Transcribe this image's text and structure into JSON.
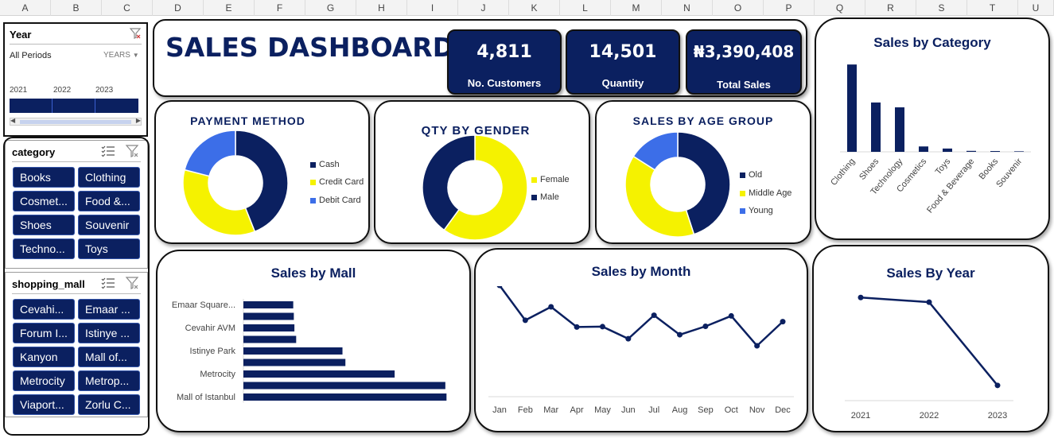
{
  "columns": [
    "A",
    "B",
    "C",
    "D",
    "E",
    "F",
    "G",
    "H",
    "I",
    "J",
    "K",
    "L",
    "M",
    "N",
    "O",
    "P",
    "Q",
    "R",
    "S",
    "T",
    "U"
  ],
  "colors": {
    "navy": "#0b2060",
    "yellow": "#f5f200",
    "blue": "#3c6ee8"
  },
  "title": "SALES DASHBOARD",
  "kpis": [
    {
      "value": "4,811",
      "label": "No. Customers"
    },
    {
      "value": "14,501",
      "label": "Quantity"
    },
    {
      "value": "₦3,390,408",
      "label": "Total Sales"
    }
  ],
  "year_slicer": {
    "header": "Year",
    "filter_label": "All Periods",
    "level_label": "YEARS",
    "years": [
      "2021",
      "2022",
      "2023"
    ]
  },
  "category_slicer": {
    "header": "category",
    "items": [
      "Books",
      "Clothing",
      "Cosmet...",
      "Food &...",
      "Shoes",
      "Souvenir",
      "Techno...",
      "Toys"
    ]
  },
  "mall_slicer": {
    "header": "shopping_mall",
    "items": [
      "Cevahi...",
      "Emaar ...",
      "Forum I...",
      "Istinye ...",
      "Kanyon",
      "Mall of...",
      "Metrocity",
      "Metrop...",
      "Viaport...",
      "Zorlu C..."
    ]
  },
  "payment": {
    "title": "PAYMENT METHOD",
    "legend": [
      "Cash",
      "Credit Card",
      "Debit Card"
    ]
  },
  "gender": {
    "title": "QTY BY GENDER",
    "legend": [
      "Female",
      "Male"
    ]
  },
  "age": {
    "title": "SALES BY AGE GROUP",
    "legend": [
      "Old",
      "Middle Age",
      "Young"
    ]
  },
  "chart_data": [
    {
      "type": "pie",
      "categories": [
        "Cash",
        "Credit Card",
        "Debit Card"
      ],
      "values": [
        44,
        35,
        21
      ],
      "colors": [
        "#0b2060",
        "#f5f200",
        "#3c6ee8"
      ]
    },
    {
      "type": "pie",
      "categories": [
        "Female",
        "Male"
      ],
      "values": [
        60,
        40
      ],
      "colors": [
        "#f5f200",
        "#0b2060"
      ]
    },
    {
      "type": "pie",
      "categories": [
        "Old",
        "Middle Age",
        "Young"
      ],
      "values": [
        45,
        39,
        16
      ],
      "colors": [
        "#0b2060",
        "#f5f200",
        "#3c6ee8"
      ]
    },
    {
      "type": "bar",
      "title": "Sales by Category",
      "categories": [
        "Clothing",
        "Shoes",
        "Technology",
        "Cosmetics",
        "Toys",
        "Food & Beverage",
        "Books",
        "Souvenir"
      ],
      "values": [
        1007,
        569,
        513,
        62,
        38,
        11,
        9,
        6
      ],
      "ylim": [
        0,
        1100
      ]
    },
    {
      "type": "bar",
      "orientation": "horizontal",
      "title": "Sales by Mall",
      "categories": [
        "Emaar Square...",
        "",
        "Cevahir AVM",
        "",
        "Istinye Park",
        "",
        "Metrocity",
        "",
        "Mall of Istanbul"
      ],
      "values": [
        170,
        172,
        174,
        180,
        338,
        348,
        516,
        689,
        693
      ],
      "xlim": [
        0,
        760
      ]
    },
    {
      "type": "line",
      "title": "Sales by Month",
      "x": [
        "Jan",
        "Feb",
        "Mar",
        "Apr",
        "May",
        "Jun",
        "Jul",
        "Aug",
        "Sep",
        "Oct",
        "Nov",
        "Dec"
      ],
      "values": [
        405,
        301,
        341,
        281,
        282,
        246,
        316,
        258,
        283,
        314,
        225,
        297
      ],
      "ylim": [
        0,
        450
      ]
    },
    {
      "type": "line",
      "title": "Sales By Year",
      "x": [
        "2021",
        "2022",
        "2023"
      ],
      "values": [
        1460,
        1410,
        520
      ],
      "ylim": [
        0,
        1700
      ]
    }
  ]
}
